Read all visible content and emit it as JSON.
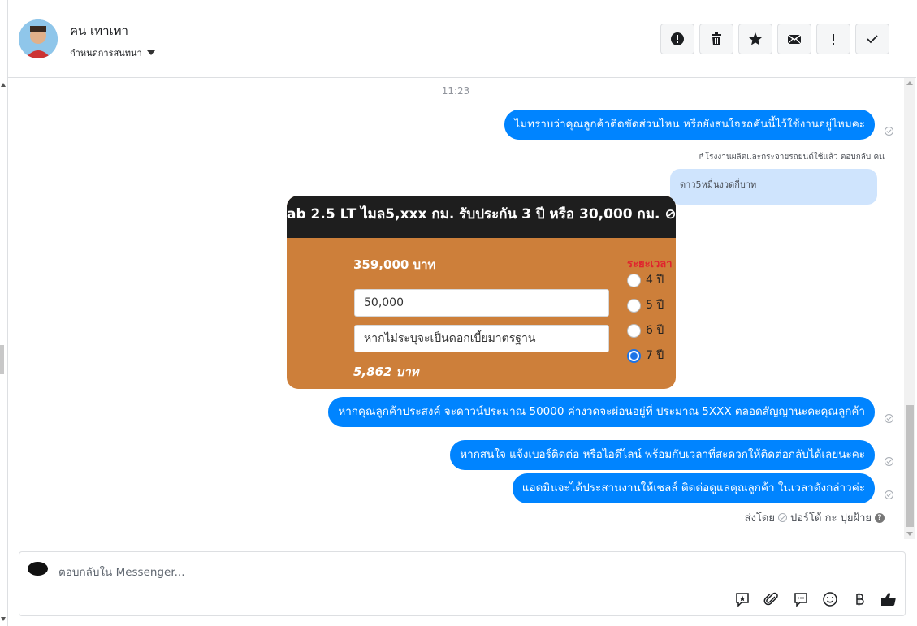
{
  "header": {
    "contact_name": "คน เทาเทา",
    "manage_label": "กำหนดการสนทนา",
    "actions": [
      {
        "name": "report-icon"
      },
      {
        "name": "trash-icon"
      },
      {
        "name": "star-icon"
      },
      {
        "name": "envelope-icon"
      },
      {
        "name": "exclamation-icon"
      },
      {
        "name": "checkmark-icon"
      }
    ]
  },
  "conversation": {
    "timestamp": "11:23",
    "messages": [
      {
        "text": "ไม่ทราบว่าคุณลูกค้าติดขัดส่วนไหน หรือยังสนใจรถคันนี้ไว้ใช้งานอยู่ไหมคะ"
      },
      {
        "text": "หากคุณลูกค้าประสงค์ จะดาวน์ประมาณ 50000 ค่างวดจะผ่อนอยู่ที่ ประมาณ 5XXX ตลอดสัญญานะคะคุณลูกค้า"
      },
      {
        "text": "หากสนใจ แจ้งเบอร์ติดต่อ หรือไอดีไลน์ พร้อมกับเวลาที่สะดวกให้ติดต่อกลับได้เลยนะคะ"
      },
      {
        "text": "แอดมินจะได้ประสานงานให้เซลล์ ติดต่อดูแลคุณลูกค้า ในเวลาดังกล่าวค่ะ"
      }
    ],
    "reply_note": "↱โรงงานผลิตและกระจายรถยนต์ใช้แล้ว ตอบกลับ คน",
    "reply_text": "ดาว5หมื่นงวดกี่บาท",
    "attachment": {
      "header_text": "ab 2.5 LT ไมล5,xxx กม. รับประกัน 3 ปี หรือ 30,000 กม.",
      "price": "359,000 บาท",
      "down_payment": "50,000",
      "interest_placeholder": "หากไม่ระบุจะเป็นดอกเบี้ยมาตรฐาน",
      "monthly": "5,862 บาท",
      "period_title": "ระยะเวลา",
      "periods": [
        {
          "label": "4 ปี",
          "selected": false
        },
        {
          "label": "5 ปี",
          "selected": false
        },
        {
          "label": "6 ปี",
          "selected": false
        },
        {
          "label": "7 ปี",
          "selected": true
        }
      ]
    },
    "sent_by_label": "ส่งโดย",
    "sender_name": "ปอร์โต้ กะ ปุยฝ้าย"
  },
  "composer": {
    "placeholder": "ตอบกลับใน Messenger...",
    "tools": [
      "saved-reply-icon",
      "attach-icon",
      "message-icon",
      "emoji-icon",
      "baht-icon",
      "like-icon"
    ]
  },
  "colors": {
    "bubble_blue": "#0084ff",
    "reply_bubble": "#cfe4fd",
    "attachment_orange": "#cd7f3a"
  }
}
